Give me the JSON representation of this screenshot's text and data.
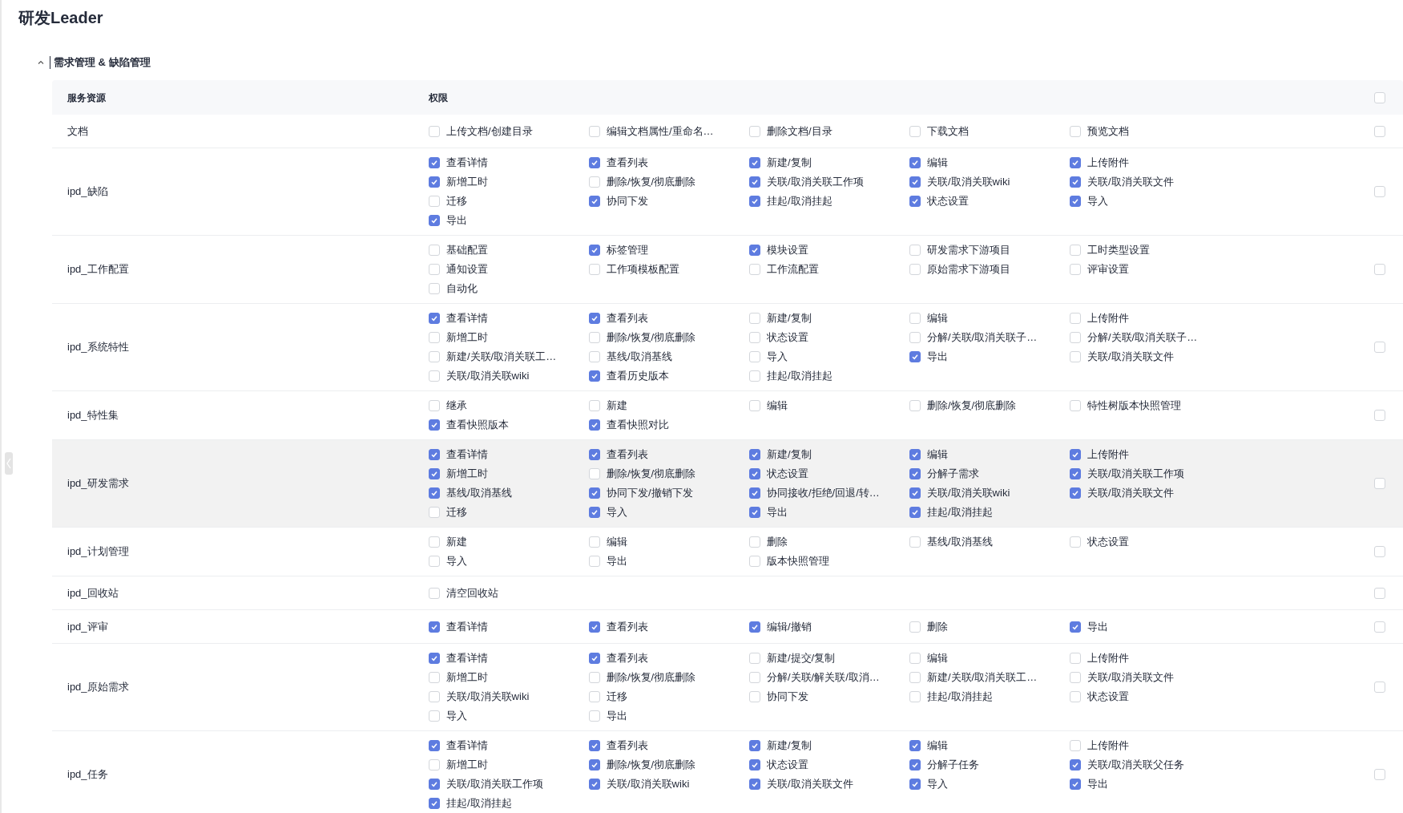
{
  "page_title": "研发Leader",
  "section": {
    "title": "需求管理 & 缺陷管理",
    "expanded": true
  },
  "table": {
    "columns": [
      "服务资源",
      "权限"
    ],
    "all_checked": false,
    "rows": [
      {
        "resource": "文档",
        "hovered": false,
        "checked": false,
        "permissions": [
          {
            "label": "上传文档/创建目录",
            "checked": false
          },
          {
            "label": "编辑文档属性/重命名…",
            "checked": false
          },
          {
            "label": "删除文档/目录",
            "checked": false
          },
          {
            "label": "下载文档",
            "checked": false
          },
          {
            "label": "预览文档",
            "checked": false
          }
        ]
      },
      {
        "resource": "ipd_缺陷",
        "hovered": false,
        "checked": false,
        "permissions": [
          {
            "label": "查看详情",
            "checked": true
          },
          {
            "label": "查看列表",
            "checked": true
          },
          {
            "label": "新建/复制",
            "checked": true
          },
          {
            "label": "编辑",
            "checked": true
          },
          {
            "label": "上传附件",
            "checked": true
          },
          {
            "label": "新增工时",
            "checked": true
          },
          {
            "label": "删除/恢复/彻底删除",
            "checked": false
          },
          {
            "label": "关联/取消关联工作项",
            "checked": true
          },
          {
            "label": "关联/取消关联wiki",
            "checked": true
          },
          {
            "label": "关联/取消关联文件",
            "checked": true
          },
          {
            "label": "迁移",
            "checked": false
          },
          {
            "label": "协同下发",
            "checked": true
          },
          {
            "label": "挂起/取消挂起",
            "checked": true
          },
          {
            "label": "状态设置",
            "checked": true
          },
          {
            "label": "导入",
            "checked": true
          },
          {
            "label": "导出",
            "checked": true
          }
        ]
      },
      {
        "resource": "ipd_工作配置",
        "hovered": false,
        "checked": false,
        "permissions": [
          {
            "label": "基础配置",
            "checked": false
          },
          {
            "label": "标签管理",
            "checked": true
          },
          {
            "label": "模块设置",
            "checked": true
          },
          {
            "label": "研发需求下游项目",
            "checked": false
          },
          {
            "label": "工时类型设置",
            "checked": false
          },
          {
            "label": "通知设置",
            "checked": false
          },
          {
            "label": "工作项模板配置",
            "checked": false
          },
          {
            "label": "工作流配置",
            "checked": false
          },
          {
            "label": "原始需求下游项目",
            "checked": false
          },
          {
            "label": "评审设置",
            "checked": false
          },
          {
            "label": "自动化",
            "checked": false
          }
        ]
      },
      {
        "resource": "ipd_系统特性",
        "hovered": false,
        "checked": false,
        "permissions": [
          {
            "label": "查看详情",
            "checked": true
          },
          {
            "label": "查看列表",
            "checked": true
          },
          {
            "label": "新建/复制",
            "checked": false
          },
          {
            "label": "编辑",
            "checked": false
          },
          {
            "label": "上传附件",
            "checked": false
          },
          {
            "label": "新增工时",
            "checked": false
          },
          {
            "label": "删除/恢复/彻底删除",
            "checked": false
          },
          {
            "label": "状态设置",
            "checked": false
          },
          {
            "label": "分解/关联/取消关联子…",
            "checked": false
          },
          {
            "label": "分解/关联/取消关联子…",
            "checked": false
          },
          {
            "label": "新建/关联/取消关联工…",
            "checked": false
          },
          {
            "label": "基线/取消基线",
            "checked": false
          },
          {
            "label": "导入",
            "checked": false
          },
          {
            "label": "导出",
            "checked": true
          },
          {
            "label": "关联/取消关联文件",
            "checked": false
          },
          {
            "label": "关联/取消关联wiki",
            "checked": false
          },
          {
            "label": "查看历史版本",
            "checked": true
          },
          {
            "label": "挂起/取消挂起",
            "checked": false
          }
        ]
      },
      {
        "resource": "ipd_特性集",
        "hovered": false,
        "checked": false,
        "permissions": [
          {
            "label": "继承",
            "checked": false
          },
          {
            "label": "新建",
            "checked": false
          },
          {
            "label": "编辑",
            "checked": false
          },
          {
            "label": "删除/恢复/彻底删除",
            "checked": false
          },
          {
            "label": "特性树版本快照管理",
            "checked": false
          },
          {
            "label": "查看快照版本",
            "checked": true
          },
          {
            "label": "查看快照对比",
            "checked": true
          }
        ]
      },
      {
        "resource": "ipd_研发需求",
        "hovered": true,
        "checked": false,
        "permissions": [
          {
            "label": "查看详情",
            "checked": true
          },
          {
            "label": "查看列表",
            "checked": true
          },
          {
            "label": "新建/复制",
            "checked": true
          },
          {
            "label": "编辑",
            "checked": true
          },
          {
            "label": "上传附件",
            "checked": true
          },
          {
            "label": "新增工时",
            "checked": true
          },
          {
            "label": "删除/恢复/彻底删除",
            "checked": false
          },
          {
            "label": "状态设置",
            "checked": true
          },
          {
            "label": "分解子需求",
            "checked": true
          },
          {
            "label": "关联/取消关联工作项",
            "checked": true
          },
          {
            "label": "基线/取消基线",
            "checked": true
          },
          {
            "label": "协同下发/撤销下发",
            "checked": true
          },
          {
            "label": "协同接收/拒绝/回退/转…",
            "checked": true
          },
          {
            "label": "关联/取消关联wiki",
            "checked": true
          },
          {
            "label": "关联/取消关联文件",
            "checked": true
          },
          {
            "label": "迁移",
            "checked": false
          },
          {
            "label": "导入",
            "checked": true
          },
          {
            "label": "导出",
            "checked": true
          },
          {
            "label": "挂起/取消挂起",
            "checked": true
          }
        ]
      },
      {
        "resource": "ipd_计划管理",
        "hovered": false,
        "checked": false,
        "permissions": [
          {
            "label": "新建",
            "checked": false
          },
          {
            "label": "编辑",
            "checked": false
          },
          {
            "label": "删除",
            "checked": false
          },
          {
            "label": "基线/取消基线",
            "checked": false
          },
          {
            "label": "状态设置",
            "checked": false
          },
          {
            "label": "导入",
            "checked": false
          },
          {
            "label": "导出",
            "checked": false
          },
          {
            "label": "版本快照管理",
            "checked": false
          }
        ]
      },
      {
        "resource": "ipd_回收站",
        "hovered": false,
        "checked": false,
        "permissions": [
          {
            "label": "清空回收站",
            "checked": false
          }
        ]
      },
      {
        "resource": "ipd_评审",
        "hovered": false,
        "checked": false,
        "permissions": [
          {
            "label": "查看详情",
            "checked": true
          },
          {
            "label": "查看列表",
            "checked": true
          },
          {
            "label": "编辑/撤销",
            "checked": true
          },
          {
            "label": "删除",
            "checked": false
          },
          {
            "label": "导出",
            "checked": true
          }
        ]
      },
      {
        "resource": "ipd_原始需求",
        "hovered": false,
        "checked": false,
        "permissions": [
          {
            "label": "查看详情",
            "checked": true
          },
          {
            "label": "查看列表",
            "checked": true
          },
          {
            "label": "新建/提交/复制",
            "checked": false
          },
          {
            "label": "编辑",
            "checked": false
          },
          {
            "label": "上传附件",
            "checked": false
          },
          {
            "label": "新增工时",
            "checked": false
          },
          {
            "label": "删除/恢复/彻底删除",
            "checked": false
          },
          {
            "label": "分解/关联/解关联/取消…",
            "checked": false
          },
          {
            "label": "新建/关联/取消关联工…",
            "checked": false
          },
          {
            "label": "关联/取消关联文件",
            "checked": false
          },
          {
            "label": "关联/取消关联wiki",
            "checked": false
          },
          {
            "label": "迁移",
            "checked": false
          },
          {
            "label": "协同下发",
            "checked": false
          },
          {
            "label": "挂起/取消挂起",
            "checked": false
          },
          {
            "label": "状态设置",
            "checked": false
          },
          {
            "label": "导入",
            "checked": false
          },
          {
            "label": "导出",
            "checked": false
          }
        ]
      },
      {
        "resource": "ipd_任务",
        "hovered": false,
        "checked": false,
        "permissions": [
          {
            "label": "查看详情",
            "checked": true
          },
          {
            "label": "查看列表",
            "checked": true
          },
          {
            "label": "新建/复制",
            "checked": true
          },
          {
            "label": "编辑",
            "checked": true
          },
          {
            "label": "上传附件",
            "checked": false
          },
          {
            "label": "新增工时",
            "checked": false
          },
          {
            "label": "删除/恢复/彻底删除",
            "checked": true
          },
          {
            "label": "状态设置",
            "checked": true
          },
          {
            "label": "分解子任务",
            "checked": true
          },
          {
            "label": "关联/取消关联父任务",
            "checked": true
          },
          {
            "label": "关联/取消关联工作项",
            "checked": true
          },
          {
            "label": "关联/取消关联wiki",
            "checked": true
          },
          {
            "label": "关联/取消关联文件",
            "checked": true
          },
          {
            "label": "导入",
            "checked": true
          },
          {
            "label": "导出",
            "checked": true
          },
          {
            "label": "挂起/取消挂起",
            "checked": true
          }
        ]
      }
    ]
  }
}
